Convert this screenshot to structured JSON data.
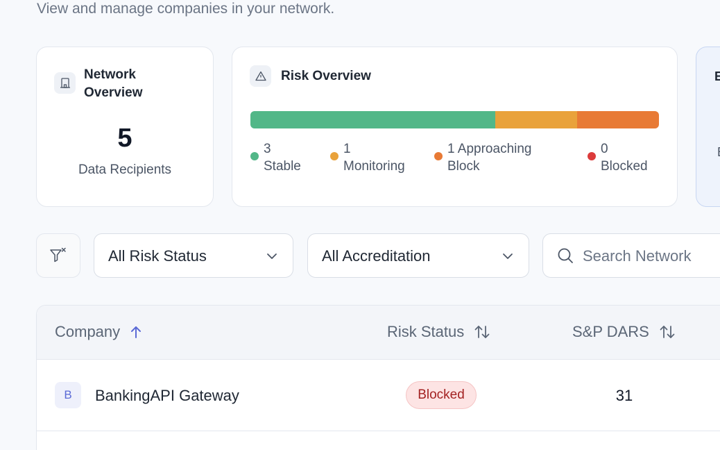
{
  "header": {
    "subtitle": "View and manage companies in your network."
  },
  "network_card": {
    "title": "Network Overview",
    "icon": "building-icon",
    "count": "5",
    "count_label": "Data Recipients"
  },
  "risk_card": {
    "title": "Risk Overview",
    "icon": "warning-triangle-icon",
    "bar": [
      {
        "key": "stable",
        "value": 3,
        "color": "#52b788"
      },
      {
        "key": "monitoring",
        "value": 1,
        "color": "#e9a23b"
      },
      {
        "key": "approaching",
        "value": 1,
        "color": "#e87a35"
      },
      {
        "key": "blocked",
        "value": 0,
        "color": "#dc3b3b"
      }
    ],
    "legend": [
      {
        "count": "3",
        "label": "Stable",
        "color": "#52b788"
      },
      {
        "count": "1",
        "label": "Monitoring",
        "color": "#e9a23b"
      },
      {
        "count": "1 Approaching",
        "label": "Block",
        "color": "#e87a35"
      },
      {
        "count": "0",
        "label": "Blocked",
        "color": "#dc3b3b"
      }
    ]
  },
  "partial_card": {
    "letter_top": "E",
    "letter_bottom": "E"
  },
  "filters": {
    "clear_icon": "filter-clear-icon",
    "risk_status": {
      "selected": "All Risk Status"
    },
    "accreditation": {
      "selected": "All Accreditation"
    },
    "search": {
      "value": "",
      "placeholder": "Search Network"
    }
  },
  "table": {
    "columns": [
      {
        "label": "Company",
        "sort": "asc"
      },
      {
        "label": "Risk Status",
        "sort": "none"
      },
      {
        "label": "S&P DARS",
        "sort": "none"
      }
    ],
    "rows": [
      {
        "avatar": "B",
        "company": "BankingAPI Gateway",
        "risk_status": "Blocked",
        "sp_dars": "31"
      }
    ]
  },
  "colors": {
    "accent": "#5b6ad6",
    "blocked_badge_bg": "#fde4e4",
    "blocked_badge_text": "#a32222"
  }
}
